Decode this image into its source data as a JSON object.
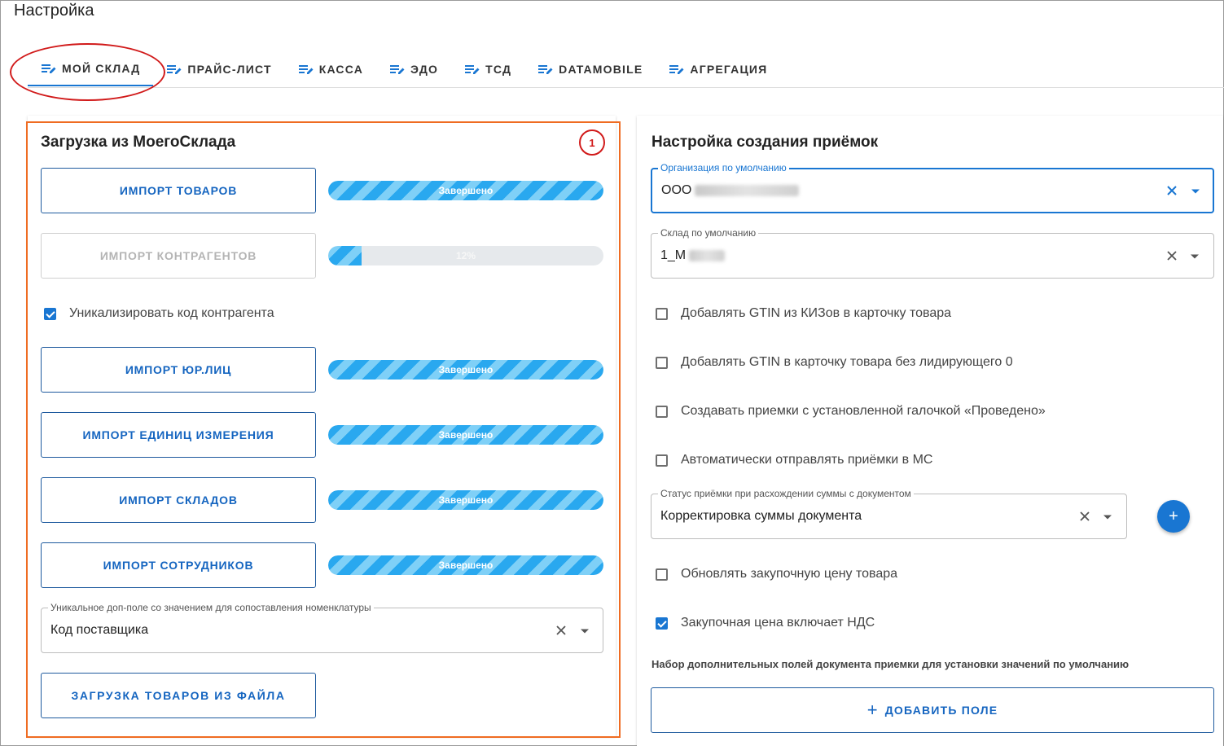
{
  "page": {
    "title": "Настройка"
  },
  "tabs": [
    {
      "label": "МОЙ СКЛАД",
      "icon": "edit-list-icon",
      "active": true
    },
    {
      "label": "ПРАЙС-ЛИСТ",
      "icon": "edit-list-icon"
    },
    {
      "label": "КАССА",
      "icon": "edit-list-icon"
    },
    {
      "label": "ЭДО",
      "icon": "edit-list-icon"
    },
    {
      "label": "ТСД",
      "icon": "edit-list-icon"
    },
    {
      "label": "DATAMOBILE",
      "icon": "edit-list-icon"
    },
    {
      "label": "АГРЕГАЦИЯ",
      "icon": "edit-list-icon"
    }
  ],
  "left": {
    "title": "Загрузка из МоегоСклада",
    "badge": "1",
    "imports": [
      {
        "label": "ИМПОРТ ТОВАРОВ",
        "progress_percent": 100,
        "status": "Завершено",
        "disabled": false
      },
      {
        "label": "ИМПОРТ КОНТРАГЕНТОВ",
        "progress_percent": 12,
        "status": "12%",
        "disabled": true
      }
    ],
    "unique_code_checkbox": {
      "label": "Уникализировать код контрагента",
      "checked": true
    },
    "imports2": [
      {
        "label": "ИМПОРТ ЮР.ЛИЦ",
        "progress_percent": 100,
        "status": "Завершено"
      },
      {
        "label": "ИМПОРТ ЕДИНИЦ ИЗМЕРЕНИЯ",
        "progress_percent": 100,
        "status": "Завершено"
      },
      {
        "label": "ИМПОРТ СКЛАДОВ",
        "progress_percent": 100,
        "status": "Завершено"
      },
      {
        "label": "ИМПОРТ СОТРУДНИКОВ",
        "progress_percent": 100,
        "status": "Завершено"
      }
    ],
    "match_field": {
      "legend": "Уникальное доп-поле со значением для сопоставления номенклатуры",
      "value": "Код поставщика"
    },
    "file_button": "ЗАГРУЗКА ТОВАРОВ ИЗ ФАЙЛА"
  },
  "right": {
    "title": "Настройка создания приёмок",
    "org_field": {
      "legend": "Организация по умолчанию",
      "value": "ООО"
    },
    "warehouse_field": {
      "legend": "Склад по умолчанию",
      "value": "1_М"
    },
    "checkboxes1": [
      {
        "label": "Добавлять GTIN из КИЗов в карточку товара",
        "checked": false
      },
      {
        "label": "Добавлять GTIN в карточку товара без лидирующего 0",
        "checked": false
      },
      {
        "label": "Создавать приемки с установленной галочкой «Проведено»",
        "checked": false
      },
      {
        "label": "Автоматически отправлять приёмки в МС",
        "checked": false
      }
    ],
    "status_field": {
      "legend": "Статус приёмки при расхождении суммы с документом",
      "value": "Корректировка суммы документа"
    },
    "fab_label": "+",
    "checkboxes2": [
      {
        "label": "Обновлять закупочную цену товара",
        "checked": false
      },
      {
        "label": "Закупочная цена включает НДС",
        "checked": true
      }
    ],
    "extra_note": "Набор дополнительных полей документа приемки для установки значений по умолчанию",
    "add_field_button": {
      "plus": "+",
      "label": "ДОБАВИТЬ ПОЛЕ"
    }
  },
  "colors": {
    "accent": "#1976d2",
    "annotation_red": "#d11a1a",
    "annotation_orange": "#ef6c22",
    "progress_stripe": "#29a8ef"
  }
}
